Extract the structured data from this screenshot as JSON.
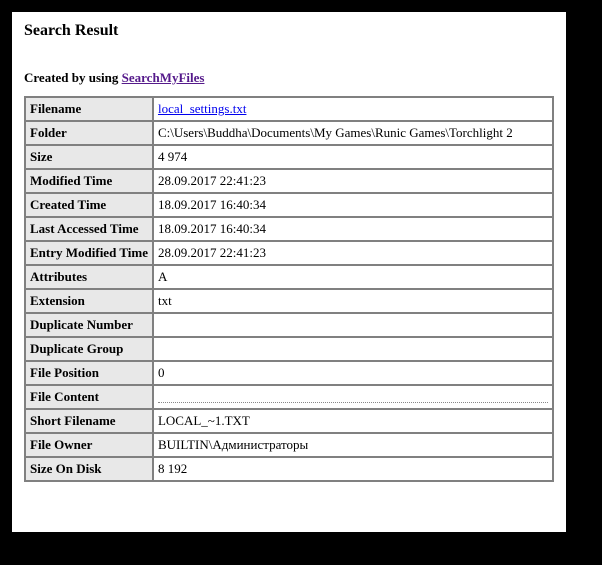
{
  "header": {
    "title": "Search Result",
    "created_prefix": "Created by using ",
    "created_link_text": "SearchMyFiles"
  },
  "rows": [
    {
      "label": "Filename",
      "value": "local_settings.txt",
      "is_link": true
    },
    {
      "label": "Folder",
      "value": "C:\\Users\\Buddha\\Documents\\My Games\\Runic Games\\Torchlight 2"
    },
    {
      "label": "Size",
      "value": "4 974"
    },
    {
      "label": "Modified Time",
      "value": "28.09.2017 22:41:23"
    },
    {
      "label": "Created Time",
      "value": "18.09.2017 16:40:34"
    },
    {
      "label": "Last Accessed Time",
      "value": "18.09.2017 16:40:34"
    },
    {
      "label": "Entry Modified Time",
      "value": "28.09.2017 22:41:23"
    },
    {
      "label": "Attributes",
      "value": "A"
    },
    {
      "label": "Extension",
      "value": "txt"
    },
    {
      "label": "Duplicate Number",
      "value": ""
    },
    {
      "label": "Duplicate Group",
      "value": ""
    },
    {
      "label": "File Position",
      "value": "0"
    },
    {
      "label": "File Content",
      "value": "",
      "dotted": true
    },
    {
      "label": "Short Filename",
      "value": "LOCAL_~1.TXT"
    },
    {
      "label": "File Owner",
      "value": "BUILTIN\\Администраторы"
    },
    {
      "label": "Size On Disk",
      "value": "8 192"
    }
  ]
}
